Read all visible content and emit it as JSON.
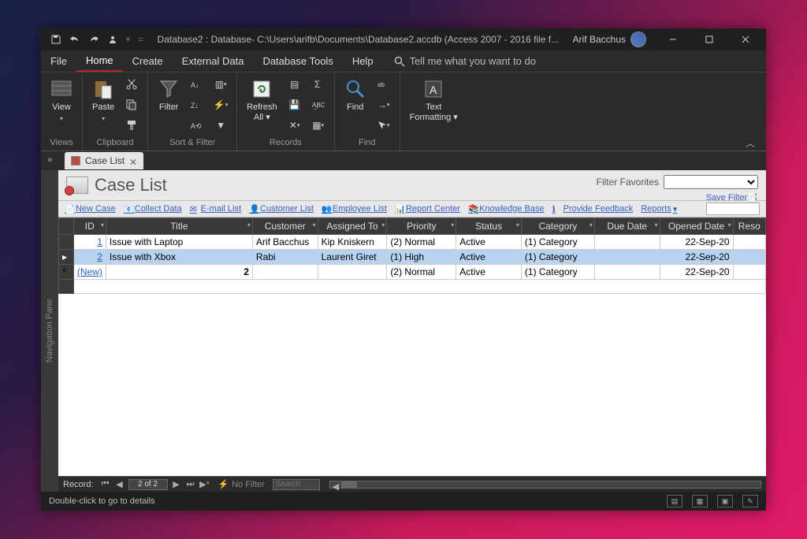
{
  "titlebar": {
    "title": "Database2 : Database- C:\\Users\\arifb\\Documents\\Database2.accdb (Access 2007 - 2016 file f...",
    "user": "Arif Bacchus"
  },
  "menu": {
    "file": "File",
    "home": "Home",
    "create": "Create",
    "external_data": "External Data",
    "database_tools": "Database Tools",
    "help": "Help",
    "tellme": "Tell me what you want to do"
  },
  "ribbon": {
    "views_label": "Views",
    "view": "View",
    "clipboard_label": "Clipboard",
    "paste": "Paste",
    "sort_filter_label": "Sort & Filter",
    "filter": "Filter",
    "records_label": "Records",
    "refresh_all": "Refresh\nAll ▾",
    "find_label": "Find",
    "find": "Find",
    "text_formatting": "Text\nFormatting ▾"
  },
  "tab": {
    "label": "Case List"
  },
  "nav_pane": "Navigation Pane",
  "form": {
    "title": "Case List",
    "filter_favorites": "Filter Favorites",
    "save_filter": "Save Filter",
    "toolbar": {
      "new_case": "New Case",
      "collect_data": "Collect Data",
      "email_list": "E-mail List",
      "customer_list": "Customer List",
      "employee_list": "Employee List",
      "report_center": "Report Center",
      "knowledge_base": "Knowledge Base",
      "provide_feedback": "Provide Feedback",
      "reports": "Reports"
    }
  },
  "grid": {
    "columns": [
      "ID",
      "Title",
      "Customer",
      "Assigned To",
      "Priority",
      "Status",
      "Category",
      "Due Date",
      "Opened Date",
      "Reso"
    ],
    "rows": [
      {
        "id": "1",
        "title": "Issue with Laptop",
        "customer": "Arif Bacchus",
        "assigned": "Kip Kniskern",
        "priority": "(2) Normal",
        "status": "Active",
        "category": "(1) Category",
        "due": "",
        "opened": "22-Sep-20"
      },
      {
        "id": "2",
        "title": "Issue with Xbox",
        "customer": "Rabi",
        "assigned": "Laurent Giret",
        "priority": "(1) High",
        "status": "Active",
        "category": "(1) Category",
        "due": "",
        "opened": "22-Sep-20"
      }
    ],
    "new_row": {
      "id_label": "(New)",
      "count": "2",
      "priority": "(2) Normal",
      "status": "Active",
      "category": "(1) Category",
      "opened": "22-Sep-20"
    }
  },
  "record_nav": {
    "label": "Record:",
    "position": "2 of 2",
    "no_filter": "No Filter",
    "search": "Search"
  },
  "statusbar": {
    "text": "Double-click to go to details"
  }
}
